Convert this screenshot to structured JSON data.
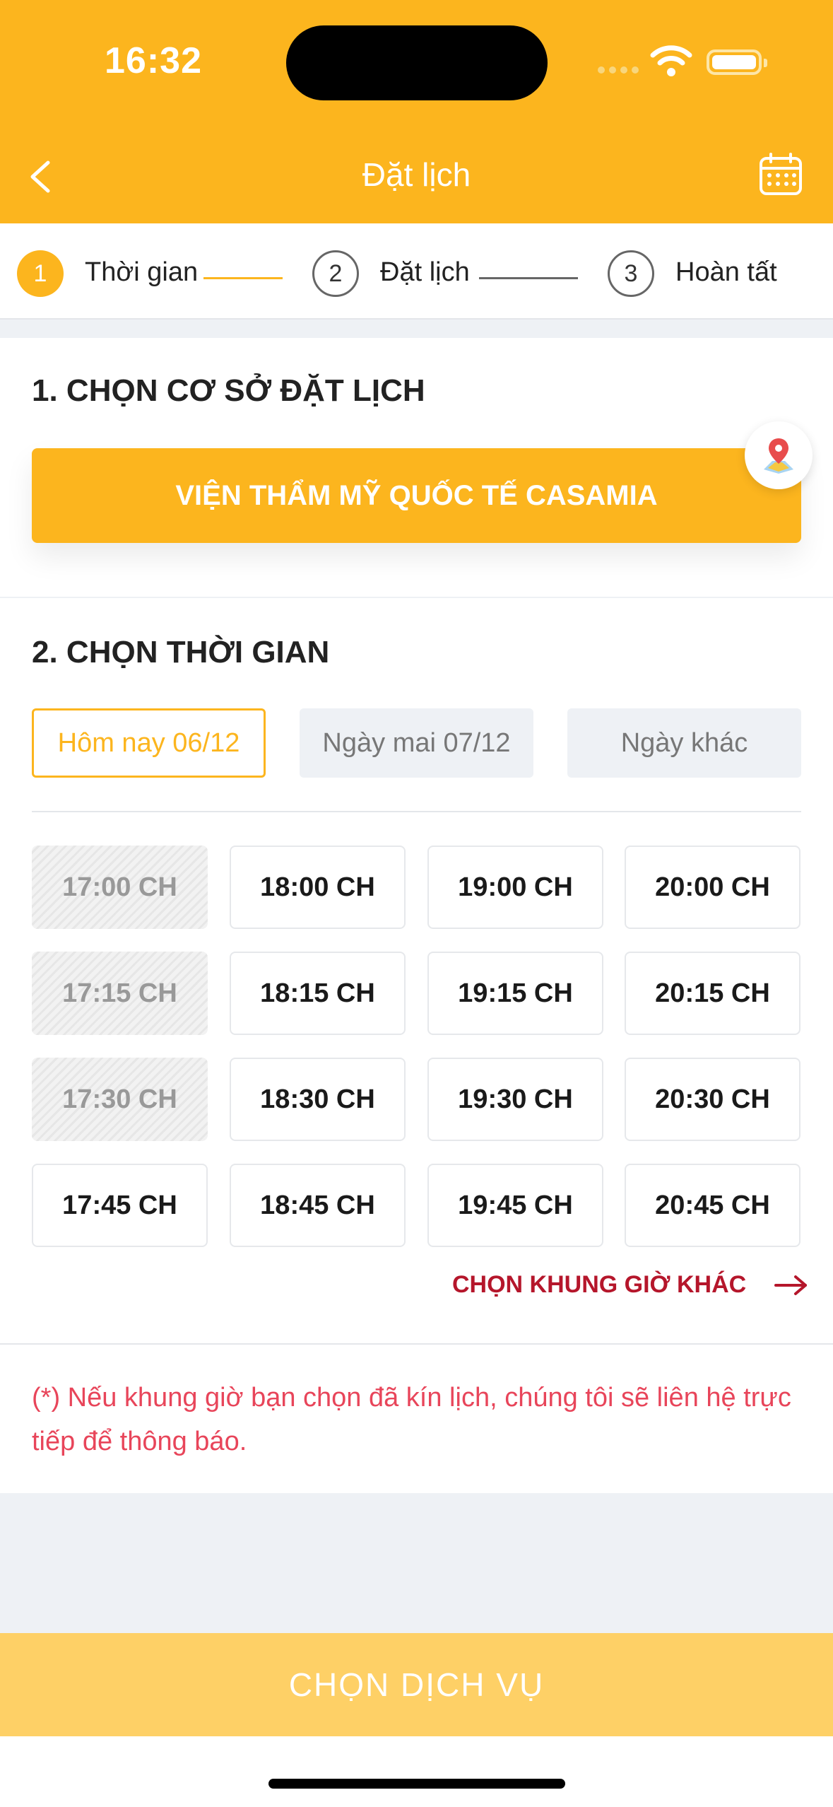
{
  "status_bar": {
    "time": "16:32"
  },
  "header": {
    "title": "Đặt lịch",
    "back_icon": "chevron-left-icon",
    "calendar_icon": "calendar-icon"
  },
  "stepper": [
    {
      "number": "1",
      "label": "Thời gian",
      "active": true
    },
    {
      "number": "2",
      "label": "Đặt lịch",
      "active": false
    },
    {
      "number": "3",
      "label": "Hoàn tất",
      "active": false
    }
  ],
  "section1": {
    "title": "1. CHỌN CƠ SỞ ĐẶT LỊCH",
    "venue": "VIỆN THẨM MỸ QUỐC TẾ CASAMIA",
    "map_icon": "map-pin-icon"
  },
  "section2": {
    "title": "2. CHỌN THỜI GIAN",
    "date_tabs": [
      {
        "label": "Hôm nay 06/12",
        "selected": true
      },
      {
        "label": "Ngày mai 07/12",
        "selected": false
      },
      {
        "label": "Ngày khác",
        "selected": false
      }
    ],
    "slots": [
      {
        "label": "17:00 CH",
        "disabled": true
      },
      {
        "label": "18:00 CH",
        "disabled": false
      },
      {
        "label": "19:00 CH",
        "disabled": false
      },
      {
        "label": "20:00 CH",
        "disabled": false
      },
      {
        "label": "17:15 CH",
        "disabled": true
      },
      {
        "label": "18:15 CH",
        "disabled": false
      },
      {
        "label": "19:15 CH",
        "disabled": false
      },
      {
        "label": "20:15 CH",
        "disabled": false
      },
      {
        "label": "17:30 CH",
        "disabled": true
      },
      {
        "label": "18:30 CH",
        "disabled": false
      },
      {
        "label": "19:30 CH",
        "disabled": false
      },
      {
        "label": "20:30 CH",
        "disabled": false
      },
      {
        "label": "17:45 CH",
        "disabled": false
      },
      {
        "label": "18:45 CH",
        "disabled": false
      },
      {
        "label": "19:45 CH",
        "disabled": false
      },
      {
        "label": "20:45 CH",
        "disabled": false
      }
    ],
    "other_time_label": "CHỌN KHUNG GIỜ KHÁC",
    "note": "(*) Nếu khung giờ bạn chọn đã kín lịch, chúng tôi sẽ liên hệ trực tiếp để thông báo."
  },
  "cta": {
    "label": "CHỌN DỊCH VỤ"
  },
  "colors": {
    "brand": "#fcb51e",
    "cta": "#fed066",
    "accent_red": "#b5162b",
    "note_red": "#e8455a"
  }
}
